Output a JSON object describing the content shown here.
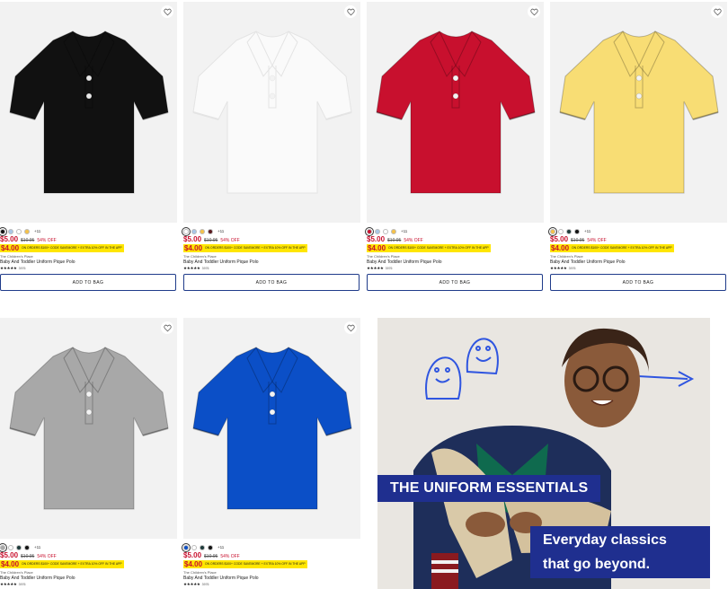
{
  "product_common": {
    "brand": "The Children's Place",
    "name": "Baby And Toddler Uniform Pique Polo",
    "price_now": "$5.00",
    "price_was": "$10.95",
    "discount": "54% OFF",
    "price_code": "$4.00",
    "promo_text": "ON ORDERS $100+ CODE SAVEMORE + EXTRA 10% OFF IN THE APP",
    "rating_stars": "★★★★★",
    "add_to_bag": "ADD TO BAG"
  },
  "products": [
    {
      "color": "#111111",
      "swatches": [
        "#111111",
        "#a9c7e8",
        "#ffffff",
        "#f5c24a"
      ],
      "more": "+11",
      "rating_count": "3976"
    },
    {
      "color": "#fafafa",
      "swatches": [
        "#ffffff",
        "#a9c7e8",
        "#f5c24a",
        "#5a1a1f"
      ],
      "more": "+11",
      "rating_count": "3976"
    },
    {
      "color": "#c8102e",
      "swatches": [
        "#c8102e",
        "#a9c7e8",
        "#ffffff",
        "#f5c24a"
      ],
      "more": "+11",
      "rating_count": "3976"
    },
    {
      "color": "#f8dd74",
      "swatches": [
        "#f5c24a",
        "#ffffff",
        "#1d3a3a",
        "#111111"
      ],
      "more": "+11",
      "rating_count": "3976"
    },
    {
      "color": "#a8a8a8",
      "swatches": [
        "#a8a8a8",
        "#ffffff",
        "#1d3a3a",
        "#111111"
      ],
      "more": "+11",
      "rating_count": "3976"
    },
    {
      "color": "#0b4fc7",
      "swatches": [
        "#0b4fc7",
        "#ffffff",
        "#1d3a3a",
        "#111111"
      ],
      "more": "+11",
      "rating_count": "3976"
    }
  ],
  "promo_banner": {
    "headline": "THE UNIFORM ESSENTIALS",
    "sub_line1": "Everyday classics",
    "sub_line2": "that go beyond.",
    "accent": "#1f2f8f"
  }
}
